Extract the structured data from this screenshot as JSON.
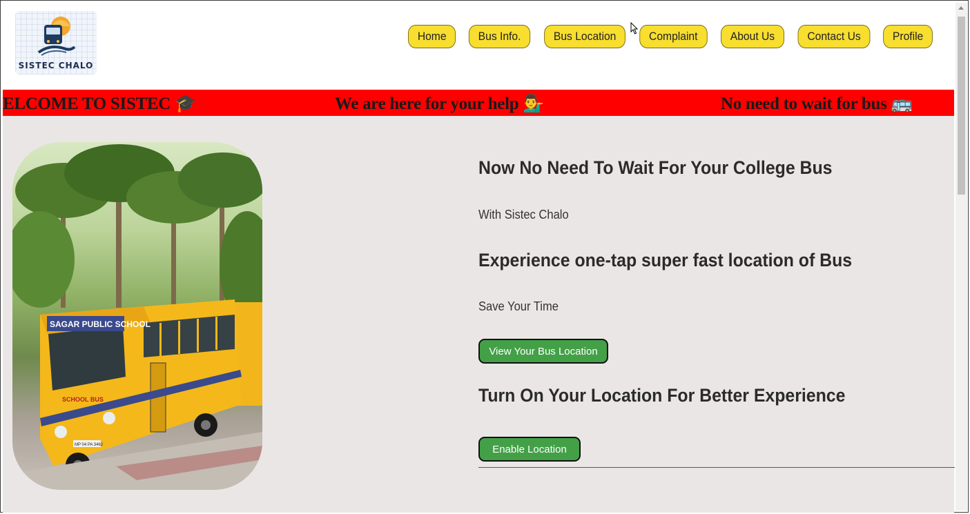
{
  "brand": {
    "logo_text": "SISTEC CHALO"
  },
  "nav": {
    "items": [
      {
        "label": "Home"
      },
      {
        "label": "Bus Info."
      },
      {
        "label": "Bus Location"
      },
      {
        "label": "Complaint"
      },
      {
        "label": "About Us"
      },
      {
        "label": "Contact Us"
      },
      {
        "label": "Profile"
      }
    ]
  },
  "marquee": {
    "items": [
      {
        "text": "ELCOME TO SISTEC",
        "emoji": "🎓"
      },
      {
        "text": "We are here for your help",
        "emoji": "💁‍♂️"
      },
      {
        "text": "No need to wait for bus",
        "emoji": "🚌"
      }
    ]
  },
  "hero": {
    "heading1": "Now No Need To Wait For Your College Bus",
    "text1": "With Sistec Chalo",
    "heading2": "Experience one-tap super fast location of Bus",
    "text2": "Save Your Time",
    "button1": "View Your Bus Location",
    "heading3": "Turn On Your Location For Better Experience",
    "button2": "Enable Location"
  },
  "photo": {
    "bus_sign": "SAGAR PUBLIC SCHOOL",
    "bus_side": "SCHOOL BUS",
    "plate": "MP 04 PA 3462"
  },
  "colors": {
    "nav_button": "#f7de2f",
    "marquee_bg": "#ff0000",
    "page_bg": "#ebe6e6",
    "action_button": "#43a047"
  }
}
